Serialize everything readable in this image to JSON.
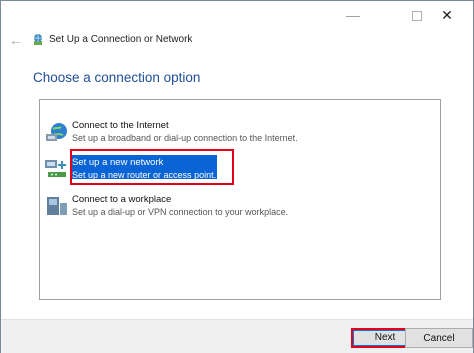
{
  "window": {
    "title": "Set Up a Connection or Network",
    "controls": {
      "minimize": "—",
      "close": "✕"
    }
  },
  "nav": {
    "back_icon": "←"
  },
  "heading": "Choose a connection option",
  "options": [
    {
      "title": "Connect to the Internet",
      "desc": "Set up a broadband or dial-up connection to the Internet.",
      "icon": "globe-network-icon",
      "selected": false
    },
    {
      "title": "Set up a new network",
      "desc": "Set up a new router or access point.",
      "icon": "router-network-icon",
      "selected": true
    },
    {
      "title": "Connect to a workplace",
      "desc": "Set up a dial-up or VPN connection to your workplace.",
      "icon": "workplace-computer-icon",
      "selected": false
    }
  ],
  "buttons": {
    "next": "Next",
    "cancel": "Cancel"
  },
  "colors": {
    "heading": "#1f4e99",
    "selection": "#0a64d6",
    "annotation": "#e3001b"
  }
}
